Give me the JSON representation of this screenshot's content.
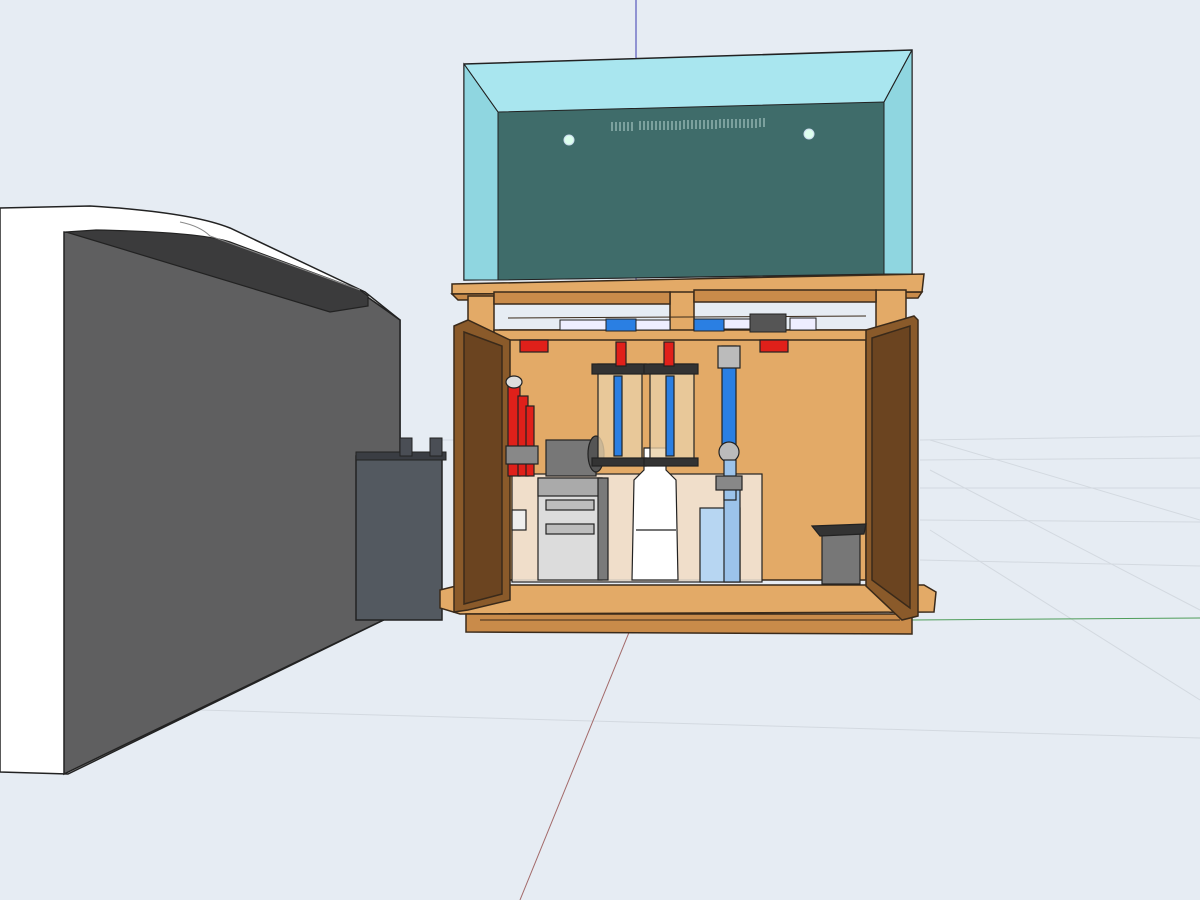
{
  "colors": {
    "sky": "#e6ecf3",
    "wood": "#e3aa67",
    "wood_dark": "#c98b4a",
    "wood_shadow": "#7a5027",
    "glass": "#a9e6ef",
    "water": "#3f6c6a",
    "pipe_red": "#e0201a",
    "pipe_blue": "#2a7fe3",
    "cabinet_gray": "#5a5c61",
    "cabinet_dark": "#464b53",
    "axis_red": "#a36a6a",
    "axis_green": "#4f9d5a",
    "axis_blue": "#3a3ab0"
  },
  "scene": {
    "objects": [
      "grid-ground",
      "adjacent-cabinet",
      "chiller-box",
      "aquarium-tank",
      "wood-stand",
      "sump",
      "reactors",
      "protein-skimmer",
      "return-pump"
    ]
  }
}
